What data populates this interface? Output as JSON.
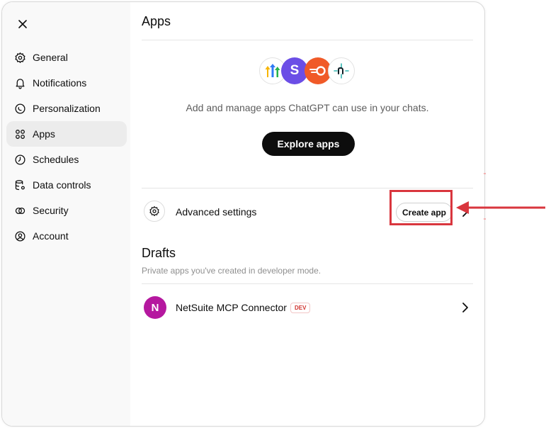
{
  "sidebar": {
    "close_icon": "close-icon",
    "items": [
      {
        "label": "General",
        "icon": "gear-icon",
        "active": false
      },
      {
        "label": "Notifications",
        "icon": "bell-icon",
        "active": false
      },
      {
        "label": "Personalization",
        "icon": "personalization-icon",
        "active": false
      },
      {
        "label": "Apps",
        "icon": "grid-icon",
        "active": true
      },
      {
        "label": "Schedules",
        "icon": "clock-icon",
        "active": false
      },
      {
        "label": "Data controls",
        "icon": "database-gear-icon",
        "active": false
      },
      {
        "label": "Security",
        "icon": "shield-icon",
        "active": false
      },
      {
        "label": "Account",
        "icon": "user-circle-icon",
        "active": false
      }
    ]
  },
  "main": {
    "title": "Apps",
    "intro": "Add and manage apps ChatGPT can use in your chats.",
    "explore_label": "Explore apps",
    "advanced_label": "Advanced settings",
    "create_label": "Create app",
    "drafts_title": "Drafts",
    "drafts_subtitle": "Private apps you've created in developer mode.",
    "drafts": [
      {
        "avatar_letter": "N",
        "name": "NetSuite MCP Connector",
        "badge": "DEV",
        "avatar_color": "#b5189f"
      }
    ]
  },
  "colors": {
    "accent_dark": "#0d0d0d",
    "annotation_red": "#d9363e",
    "dev_badge_red": "#d0312d",
    "sidebar_bg": "#f9f9f9",
    "active_item_bg": "#ececec"
  }
}
